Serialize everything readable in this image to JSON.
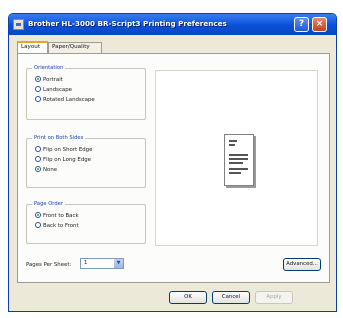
{
  "window": {
    "title": "Brother HL-3000 BR-Script3 Printing Preferences",
    "help_label": "?",
    "close_label": "×"
  },
  "tabs": [
    {
      "label": "Layout",
      "active": true
    },
    {
      "label": "Paper/Quality",
      "active": false
    }
  ],
  "orientation": {
    "label": "Orientation",
    "options": [
      {
        "label": "Portrait",
        "checked": true
      },
      {
        "label": "Landscape",
        "checked": false
      },
      {
        "label": "Rotated Landscape",
        "checked": false
      }
    ]
  },
  "print_both_sides": {
    "label": "Print on Both Sides",
    "options": [
      {
        "label": "Flip on Short Edge",
        "checked": false
      },
      {
        "label": "Flip on Long Edge",
        "checked": false
      },
      {
        "label": "None",
        "checked": true
      }
    ]
  },
  "page_order": {
    "label": "Page Order",
    "options": [
      {
        "label": "Front to Back",
        "checked": true
      },
      {
        "label": "Back to Front",
        "checked": false
      }
    ]
  },
  "pages_per_sheet": {
    "label": "Pages Per Sheet:",
    "value": "1"
  },
  "buttons": {
    "advanced": "Advanced...",
    "ok": "OK",
    "cancel": "Cancel",
    "apply": "Apply"
  }
}
